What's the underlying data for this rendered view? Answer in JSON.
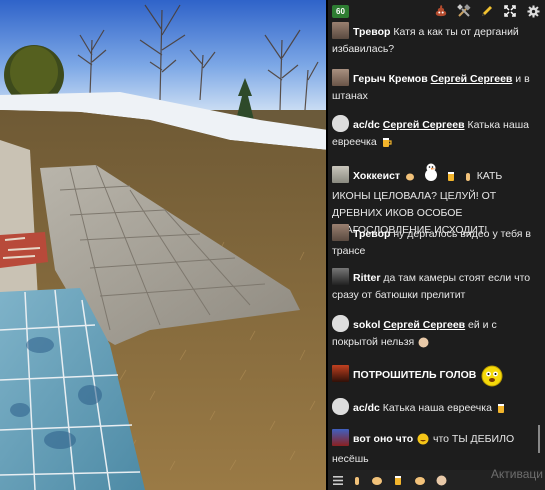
{
  "topbar": {
    "viewer_count": "60",
    "icons": [
      "poop-icon",
      "tools-icon",
      "pencil-icon",
      "move-icon",
      "gear-icon"
    ]
  },
  "messages": [
    {
      "user": "Тревор",
      "text": "Катя а как ты от дерганий избавилась?"
    },
    {
      "user": "Герыч Кремов",
      "mention": "Сергей Сергеев",
      "text": "и в штанах"
    },
    {
      "user": "ac/dc",
      "mention": "Сергей Сергеев",
      "text": "Катька наша евреечка"
    },
    {
      "user": "Хоккеист",
      "text": "КАТЬ ИКОНЫ ЦЕЛОВАЛА? ЦЕЛУЙ! ОТ ДРЕВНИХ ИКОВ ОСОБОЕ БЛАГОСЛОВЛЕНИЕ ИСХОДИТ!"
    },
    {
      "user": "Тревор",
      "text": "ну дергалось видео у тебя в трансе"
    },
    {
      "user": "Ritter",
      "text": "да там камеры стоят если что сразу от батюшки прелитит"
    },
    {
      "user": "sokol",
      "mention": "Сергей Сергеев",
      "text": "ей и с покрытой нельзя"
    },
    {
      "user": "ПОТРОШИТЕЛЬ ГОЛОВ",
      "text": ""
    },
    {
      "user": "ac/dc",
      "text": "Катька наша евреечка"
    },
    {
      "user": "вот оно что",
      "text": "что ТЫ ДЕБИЛО несёшь"
    }
  ],
  "watermark": "Активаци",
  "colors": {
    "chat_bg": "#1d1d1d",
    "viewer_badge": "#2e7d32"
  }
}
